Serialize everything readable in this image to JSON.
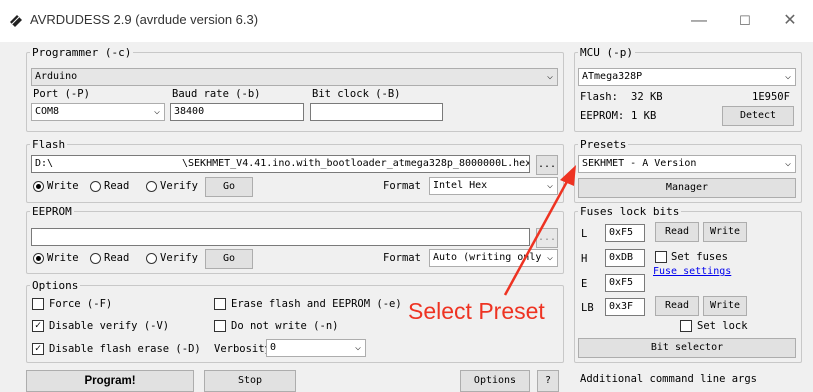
{
  "window": {
    "title": "AVRDUDESS 2.9 (avrdude version 6.3)",
    "min": "—",
    "max": "☐",
    "close": "✕"
  },
  "programmer": {
    "group": "Programmer (-c)",
    "value": "Arduino",
    "port_label": "Port (-P)",
    "port_value": "COM8",
    "baud_label": "Baud rate (-b)",
    "baud_value": "38400",
    "bitclock_label": "Bit clock (-B)",
    "bitclock_value": ""
  },
  "mcu": {
    "group": "MCU (-p)",
    "value": "ATmega328P",
    "flash_label": "Flash:",
    "flash_size": "32 KB",
    "flash_sig": "1E950F",
    "eeprom_label": "EEPROM:",
    "eeprom_size": "1 KB",
    "detect": "Detect"
  },
  "flash": {
    "group": "Flash",
    "path_prefix": "D:\\",
    "path_file": "\\SEKHMET_V4.41.ino.with_bootloader_atmega328p_8000000L.hex",
    "browse": "...",
    "write": "Write",
    "read": "Read",
    "verify": "Verify",
    "go": "Go",
    "format_label": "Format",
    "format_value": "Intel Hex"
  },
  "presets": {
    "group": "Presets",
    "value": "SEKHMET - A Version",
    "manager": "Manager"
  },
  "eeprom": {
    "group": "EEPROM",
    "path": "",
    "browse": "...",
    "write": "Write",
    "read": "Read",
    "verify": "Verify",
    "go": "Go",
    "format_label": "Format",
    "format_value": "Auto (writing only"
  },
  "fuses": {
    "group": "Fuses  lock bits",
    "l_label": "L",
    "l_value": "0xF5",
    "h_label": "H",
    "h_value": "0xDB",
    "e_label": "E",
    "e_value": "0xF5",
    "lb_label": "LB",
    "lb_value": "0x3F",
    "read": "Read",
    "write": "Write",
    "set_fuses": "Set fuses",
    "fuse_settings": "Fuse settings",
    "set_lock": "Set lock",
    "bit_selector": "Bit selector"
  },
  "options": {
    "group": "Options",
    "force": "Force (-F)",
    "disable_verify": "Disable verify (-V)",
    "disable_flash_erase": "Disable flash erase (-D)",
    "erase_flash": "Erase flash and EEPROM (-e)",
    "do_not_write": "Do not write (-n)",
    "verbosity_label": "Verbosity",
    "verbosity_value": "0"
  },
  "bottom": {
    "program": "Program!",
    "stop": "Stop",
    "options": "Options",
    "help": "?",
    "additional_args": "Additional command line args"
  },
  "annotation": {
    "text": "Select Preset",
    "color": "#ee3322"
  },
  "colors": {
    "accent": "#0078d7",
    "annotation": "#ee3322"
  },
  "icons": {
    "app": "chip-icon"
  }
}
